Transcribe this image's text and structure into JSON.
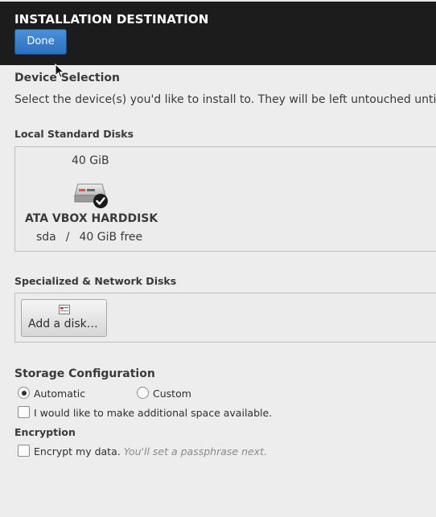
{
  "header": {
    "title": "INSTALLATION DESTINATION",
    "done_label": "Done"
  },
  "device_selection": {
    "title": "Device Selection",
    "description": "Select the device(s) you'd like to install to.  They will be left untouched until"
  },
  "local_disks": {
    "title": "Local Standard Disks",
    "disks": [
      {
        "size": "40 GiB",
        "name": "ATA VBOX HARDDISK",
        "device": "sda",
        "separator": "/",
        "free": "40 GiB free",
        "selected": true,
        "icon": "harddisk-icon"
      }
    ]
  },
  "network_disks": {
    "title": "Specialized & Network Disks",
    "add_disk_label": "Add a disk…",
    "add_disk_icon": "disk-list-icon"
  },
  "storage_configuration": {
    "title": "Storage Configuration",
    "options": [
      {
        "label": "Automatic",
        "checked": true
      },
      {
        "label": "Custom",
        "checked": false
      }
    ],
    "additional_space_label": "I would like to make additional space available.",
    "additional_space_checked": false
  },
  "encryption": {
    "title": "Encryption",
    "encrypt_label": "Encrypt my data.",
    "encrypt_hint": "You'll set a passphrase next.",
    "encrypt_checked": false
  },
  "colors": {
    "header_bg": "#1c1c1c",
    "accent": "#3b7fcf",
    "page_bg": "#ededed"
  }
}
